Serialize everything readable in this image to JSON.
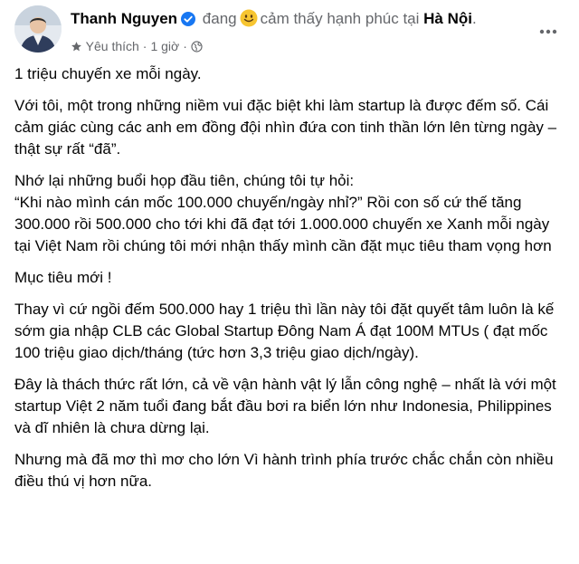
{
  "post": {
    "author": "Thanh Nguyen",
    "activity": "đang",
    "feeling": "cảm thấy hạnh phúc tại",
    "place": "Hà Nội",
    "place_suffix": ".",
    "visibility_label": "Yêu thích",
    "separator": "·",
    "timestamp": "1 giờ",
    "icons": {
      "verified": "verified-badge-icon",
      "feeling": "smiling-face-emoji-icon",
      "favorites": "star-icon",
      "audience": "globe-icon",
      "more": "more-options-icon"
    },
    "colors": {
      "verified": "#1877f2",
      "meta_text": "#65676b",
      "emoji": "#f7c531"
    }
  },
  "body": {
    "paragraphs": [
      "1 triệu chuyến xe mỗi ngày.",
      "Với tôi, một trong những niềm vui đặc biệt khi làm startup là được đếm số. Cái cảm giác cùng các anh em đồng đội nhìn đứa con tinh thần lớn lên từng ngày – thật sự rất “đã”.",
      "Nhớ lại những buổi họp đầu tiên, chúng tôi tự hỏi:",
      "Mục tiêu mới !",
      "Thay vì cứ ngồi đếm 500.000 hay 1 triệu thì lần này tôi đặt quyết tâm luôn là kế sớm gia nhập CLB các Global Startup Đông Nam Á đạt 100M MTUs ( đạt mốc 100 triệu giao dịch/tháng (tức hơn 3,3 triệu giao dịch/ngày).",
      "Đây là thách thức rất lớn, cả về vận hành vật lý lẫn công nghệ – nhất là với một startup Việt 2 năm tuổi đang bắt đầu bơi ra biển lớn như Indonesia, Philippines và dĩ nhiên là chưa dừng lại.",
      "Nhưng mà đã mơ thì mơ cho lớn Vì hành trình phía trước chắc chắn còn nhiều điều thú vị hơn nữa."
    ],
    "quote": "“Khi nào mình cán mốc 100.000 chuyến/ngày nhỉ?” Rồi con số cứ thế tăng 300.000 rồi 500.000 cho tới khi đã đạt tới 1.000.000 chuyến xe Xanh mỗi ngày tại Việt Nam rồi chúng tôi mới nhận thấy mình cần đặt mục tiêu tham vọng hơn"
  }
}
